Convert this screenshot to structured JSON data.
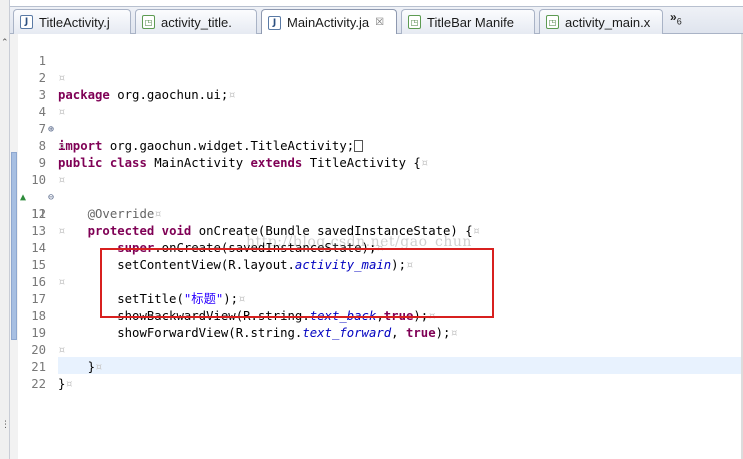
{
  "tabs": [
    {
      "label": "TitleActivity.j",
      "icon": "java-file-icon",
      "active": false
    },
    {
      "label": "activity_title.",
      "icon": "xml-file-icon",
      "active": false
    },
    {
      "label": "MainActivity.ja",
      "icon": "java-file-icon",
      "active": true,
      "close": "☒"
    },
    {
      "label": "TitleBar Manife",
      "icon": "xml-file-icon",
      "active": false
    },
    {
      "label": "activity_main.x",
      "icon": "xml-file-icon",
      "active": false
    }
  ],
  "overflow": {
    "label": "»",
    "count": "6"
  },
  "watermark": "http://blog.csdn.net/gao_chun",
  "lines": [
    {
      "n": "1"
    },
    {
      "n": "2",
      "kw1": "package",
      "t1": " org.gaochun.ui;"
    },
    {
      "n": "3"
    },
    {
      "n": "4",
      "kw1": "import",
      "t1": " org.gaochun.widget.TitleActivity;"
    },
    {
      "n": "7"
    },
    {
      "n": "8",
      "kw1": "public",
      "kw2": "class",
      "t1": " MainActivity ",
      "kw3": "extends",
      "t2": " TitleActivity {"
    },
    {
      "n": "9"
    },
    {
      "n": "10",
      "ann": "@Override"
    },
    {
      "n": "11",
      "kw1": "protected",
      "kw2": "void",
      "t1": " onCreate(Bundle savedInstanceState) {"
    },
    {
      "n": "12"
    },
    {
      "n": "13",
      "kw1": "super",
      "t1": ".onCreate(savedInstanceState);"
    },
    {
      "n": "14",
      "t1": "setContentView(R.layout.",
      "fld": "activity_main",
      "t2": ");"
    },
    {
      "n": "15"
    },
    {
      "n": "16",
      "t1": "setTitle(",
      "str": "\"标题\"",
      "t2": ");"
    },
    {
      "n": "17",
      "t1": "showBackwardView(R.string.",
      "fld": "text_back",
      "t2": ",",
      "kw1": "true",
      "t3": ");"
    },
    {
      "n": "18",
      "t1": "showForwardView(R.string.",
      "fld": "text_forward",
      "t2": ", ",
      "kw1": "true",
      "t3": ");"
    },
    {
      "n": "19"
    },
    {
      "n": "20",
      "t1": "}"
    },
    {
      "n": "21",
      "t1": "}"
    },
    {
      "n": "22"
    }
  ],
  "colors": {
    "keyword": "#7f0055",
    "field": "#0000c0",
    "string": "#2a00ff",
    "annotation": "#646464",
    "highlight_box": "#d8201f",
    "current_line": "#e8f2fe"
  }
}
